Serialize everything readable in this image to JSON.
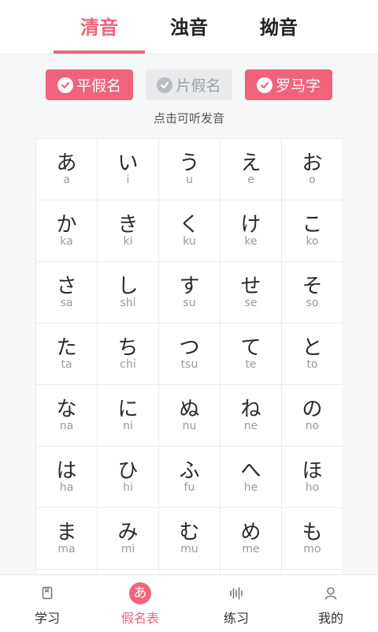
{
  "tabs": {
    "t1": "清音",
    "t2": "浊音",
    "t3": "拗音",
    "active": "清音"
  },
  "toggles": {
    "hiragana": {
      "label": "平假名",
      "on": true
    },
    "katakana": {
      "label": "片假名",
      "on": false
    },
    "romaji": {
      "label": "罗马字",
      "on": true
    }
  },
  "hint": "点击可听发音",
  "grid": {
    "rows": [
      [
        {
          "k": "あ",
          "r": "a"
        },
        {
          "k": "い",
          "r": "i"
        },
        {
          "k": "う",
          "r": "u"
        },
        {
          "k": "え",
          "r": "e"
        },
        {
          "k": "お",
          "r": "o"
        }
      ],
      [
        {
          "k": "か",
          "r": "ka"
        },
        {
          "k": "き",
          "r": "ki"
        },
        {
          "k": "く",
          "r": "ku"
        },
        {
          "k": "け",
          "r": "ke"
        },
        {
          "k": "こ",
          "r": "ko"
        }
      ],
      [
        {
          "k": "さ",
          "r": "sa"
        },
        {
          "k": "し",
          "r": "shi"
        },
        {
          "k": "す",
          "r": "su"
        },
        {
          "k": "せ",
          "r": "se"
        },
        {
          "k": "そ",
          "r": "so"
        }
      ],
      [
        {
          "k": "た",
          "r": "ta"
        },
        {
          "k": "ち",
          "r": "chi"
        },
        {
          "k": "つ",
          "r": "tsu"
        },
        {
          "k": "て",
          "r": "te"
        },
        {
          "k": "と",
          "r": "to"
        }
      ],
      [
        {
          "k": "な",
          "r": "na"
        },
        {
          "k": "に",
          "r": "ni"
        },
        {
          "k": "ぬ",
          "r": "nu"
        },
        {
          "k": "ね",
          "r": "ne"
        },
        {
          "k": "の",
          "r": "no"
        }
      ],
      [
        {
          "k": "は",
          "r": "ha"
        },
        {
          "k": "ひ",
          "r": "hi"
        },
        {
          "k": "ふ",
          "r": "fu"
        },
        {
          "k": "へ",
          "r": "he"
        },
        {
          "k": "ほ",
          "r": "ho"
        }
      ],
      [
        {
          "k": "ま",
          "r": "ma"
        },
        {
          "k": "み",
          "r": "mi"
        },
        {
          "k": "む",
          "r": "mu"
        },
        {
          "k": "め",
          "r": "me"
        },
        {
          "k": "も",
          "r": "mo"
        }
      ]
    ]
  },
  "nav": {
    "items": [
      {
        "label": "学习",
        "icon": "book-icon"
      },
      {
        "label": "假名表",
        "icon": "kana-a-icon",
        "active_glyph": "あ"
      },
      {
        "label": "练习",
        "icon": "soundwave-icon"
      },
      {
        "label": "我的",
        "icon": "user-icon"
      }
    ]
  },
  "colors": {
    "accent": "#f0637a",
    "inactive_toggle": "#e9eaec"
  }
}
